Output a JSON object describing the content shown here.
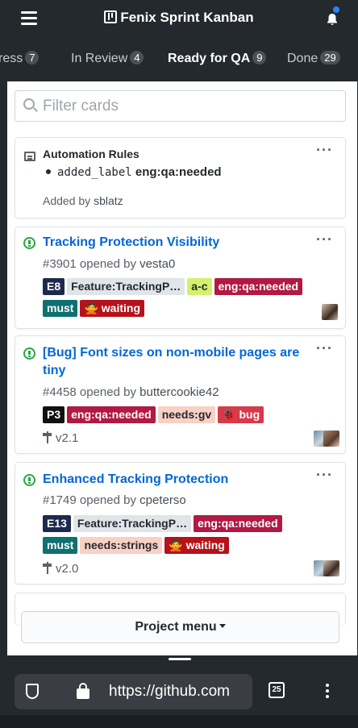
{
  "header": {
    "title": "Fenix Sprint Kanban"
  },
  "columns": [
    {
      "name": "ress",
      "count": "7"
    },
    {
      "name": "In Review",
      "count": "4"
    },
    {
      "name": "Ready for QA",
      "count": "9"
    },
    {
      "name": "Done",
      "count": "29"
    }
  ],
  "filter": {
    "placeholder": "Filter cards"
  },
  "note": {
    "title": "Automation Rules",
    "rule_key": "added_label",
    "rule_value": "eng:qa:needed",
    "added_prefix": "Added by",
    "added_by": "sblatz"
  },
  "cards": [
    {
      "title": "Tracking Protection Visibility",
      "number": "#3901",
      "opened_text": "opened by",
      "author": "vesta0",
      "labels": [
        {
          "text": "E8",
          "bg": "#1d2a4d",
          "fg": "#ffffff"
        },
        {
          "text": "Feature:TrackingP…",
          "bg": "#e1e4e8",
          "fg": "#24292e"
        },
        {
          "text": "a-c",
          "bg": "#d4f06c",
          "fg": "#24292e"
        },
        {
          "text": "eng:qa:needed",
          "bg": "#b01a44",
          "fg": "#ffffff"
        },
        {
          "text": "must",
          "bg": "#0e7070",
          "fg": "#ffffff"
        },
        {
          "text": "🙅 waiting",
          "bg": "#b5121b",
          "fg": "#ffffff"
        }
      ]
    },
    {
      "title": "[Bug] Font sizes on non-mobile pages are tiny",
      "number": "#4458",
      "opened_text": "opened by",
      "author": "buttercookie42",
      "labels": [
        {
          "text": "P3",
          "bg": "#111111",
          "fg": "#ffffff"
        },
        {
          "text": "eng:qa:needed",
          "bg": "#b01a44",
          "fg": "#ffffff"
        },
        {
          "text": "needs:gv",
          "bg": "#f9d0c4",
          "fg": "#24292e"
        },
        {
          "text": "🐞 bug",
          "bg": "#d73a4a",
          "fg": "#ffffff"
        }
      ],
      "milestone": "v2.1"
    },
    {
      "title": "Enhanced Tracking Protection",
      "number": "#1749",
      "opened_text": "opened by",
      "author": "cpeterso",
      "labels": [
        {
          "text": "E13",
          "bg": "#1d2a4d",
          "fg": "#ffffff"
        },
        {
          "text": "Feature:TrackingP…",
          "bg": "#e1e4e8",
          "fg": "#24292e"
        },
        {
          "text": "eng:qa:needed",
          "bg": "#b01a44",
          "fg": "#ffffff"
        },
        {
          "text": "must",
          "bg": "#0e7070",
          "fg": "#ffffff"
        },
        {
          "text": "needs:strings",
          "bg": "#f9d0c4",
          "fg": "#24292e"
        },
        {
          "text": "🙅 waiting",
          "bg": "#b5121b",
          "fg": "#ffffff"
        }
      ],
      "milestone": "v2.0"
    }
  ],
  "project_menu": {
    "label": "Project menu"
  },
  "browser": {
    "url": "https://github.com",
    "tab_count": "25"
  }
}
